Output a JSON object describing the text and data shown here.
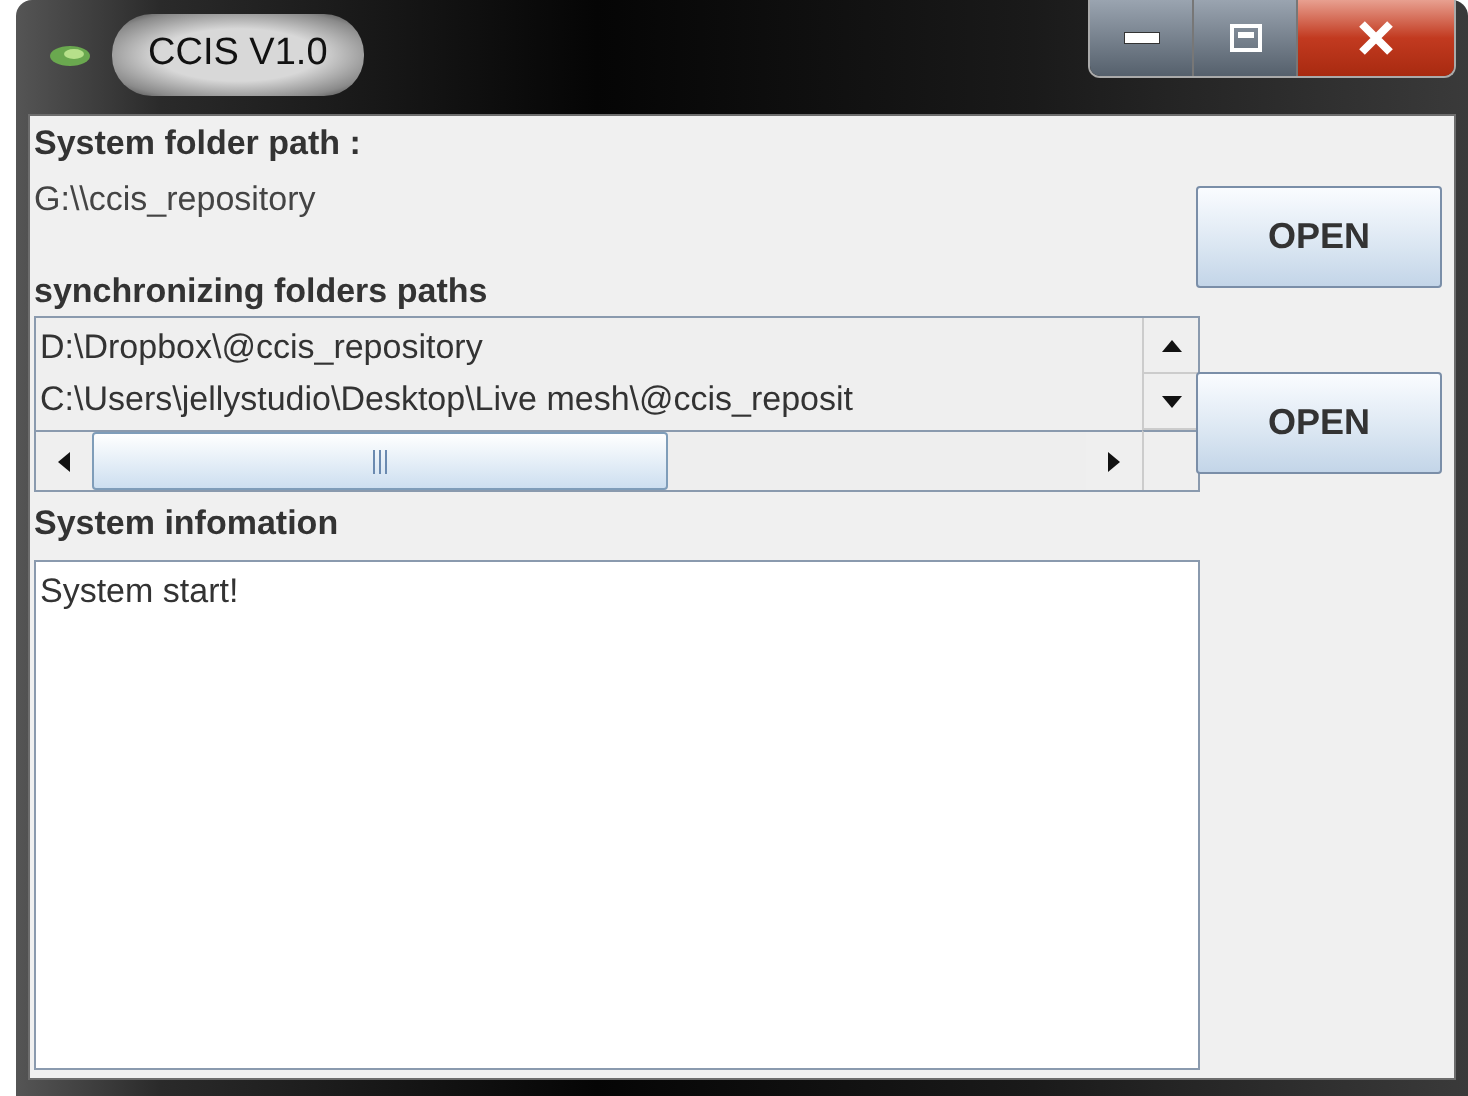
{
  "window": {
    "title": "CCIS V1.0"
  },
  "system_folder": {
    "label": "System folder path :",
    "path": "G:\\\\ccis_repository",
    "button": "OPEN"
  },
  "sync_folders": {
    "label": "synchronizing folders paths",
    "items": [
      "D:\\Dropbox\\@ccis_repository",
      "C:\\Users\\jellystudio\\Desktop\\Live mesh\\@ccis_reposit"
    ],
    "button": "OPEN"
  },
  "system_info": {
    "label": "System infomation",
    "text": "System start!"
  }
}
